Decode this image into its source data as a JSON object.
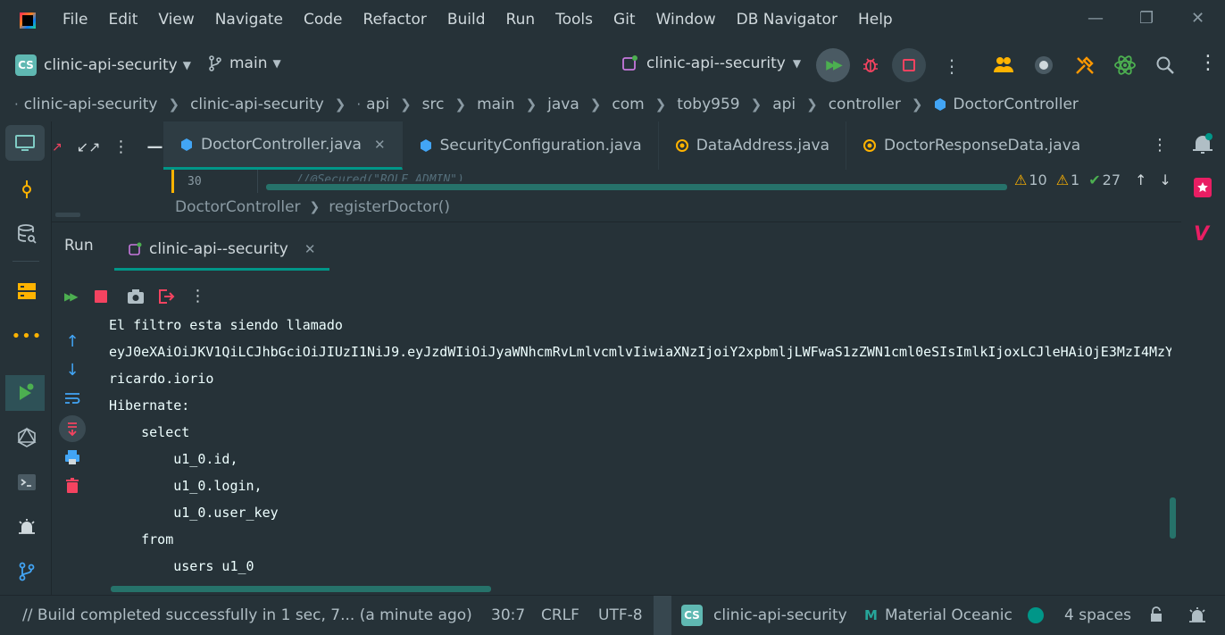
{
  "menu": {
    "items": [
      "File",
      "Edit",
      "View",
      "Navigate",
      "Code",
      "Refactor",
      "Build",
      "Run",
      "Tools",
      "Git",
      "Window",
      "DB Navigator",
      "Help"
    ]
  },
  "toolbar": {
    "project_badge": "CS",
    "project_name": "clinic-api-security",
    "branch": "main",
    "run_config": "clinic-api--security"
  },
  "breadcrumbs": [
    "clinic-api-security",
    "clinic-api-security",
    "api",
    "src",
    "main",
    "java",
    "com",
    "toby959",
    "api",
    "controller",
    "DoctorController"
  ],
  "editor": {
    "tabs": [
      {
        "label": "DoctorController.java",
        "active": true
      },
      {
        "label": "SecurityConfiguration.java",
        "active": false
      },
      {
        "label": "DataAddress.java",
        "active": false
      },
      {
        "label": "DoctorResponseData.java",
        "active": false
      }
    ],
    "line_number": "30",
    "code_fragment": "//@Secured(\"ROLE_ADMIN\")",
    "warnings": "10",
    "weak_warnings": "1",
    "typos": "27",
    "breadcrumb_class": "DoctorController",
    "breadcrumb_method": "registerDoctor()"
  },
  "run": {
    "title": "Run",
    "tab_label": "clinic-api--security",
    "console_lines": [
      "El filtro esta siendo llamado",
      "eyJ0eXAiOiJKV1QiLCJhbGciOiJIUzI1NiJ9.eyJzdWIiOiJyaWNhcmRvLmlvcmlvIiwiaXNzIjoiY2xpbmljLWFwaS1zZWN1cml0eSIsImlkIjoxLCJleHAiOjE3MzI4MzY",
      "ricardo.iorio",
      "Hibernate:",
      "    select",
      "        u1_0.id,",
      "        u1_0.login,",
      "        u1_0.user_key",
      "    from",
      "        users u1_0"
    ]
  },
  "status": {
    "build_message": "// Build completed successfully in 1 sec, 7... (a minute ago)",
    "position": "30:7",
    "line_ending": "CRLF",
    "encoding": "UTF-8",
    "project_badge": "CS",
    "project_name": "clinic-api-security",
    "theme": "Material Oceanic",
    "indent": "4 spaces"
  },
  "colors": {
    "background": "#263238",
    "accent": "#009688",
    "active_tab_bg": "#2e3c43",
    "stop_red": "#f44360",
    "run_green": "#4caf50",
    "badge_teal": "#5fb8b2"
  }
}
